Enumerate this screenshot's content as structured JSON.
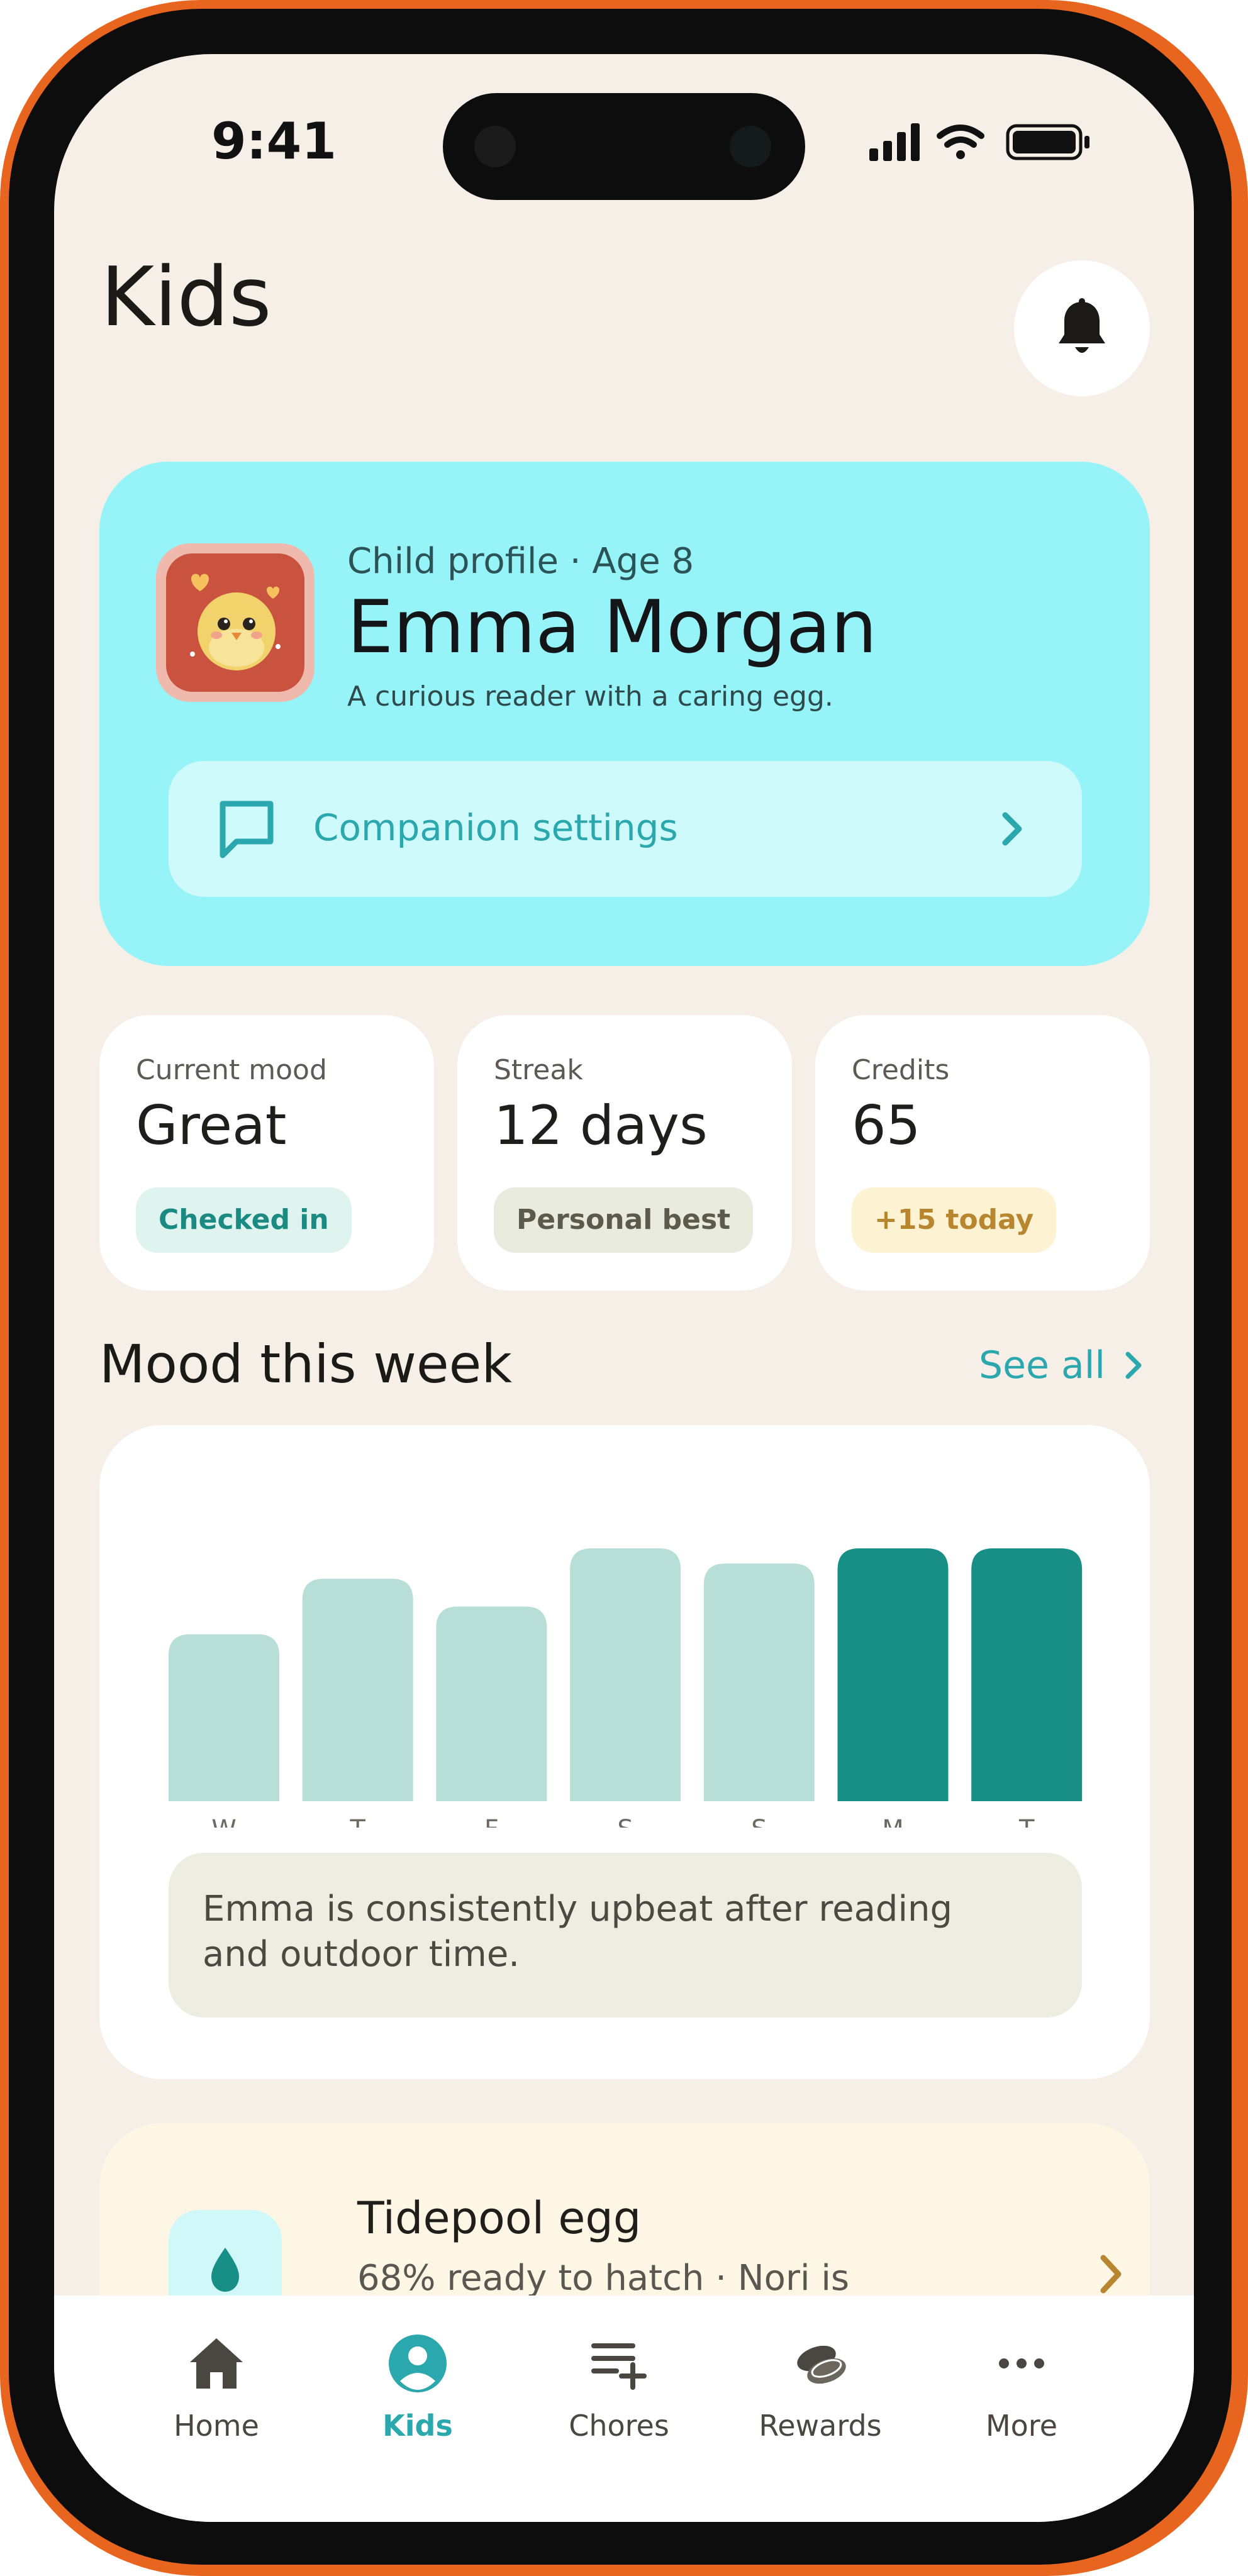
{
  "status_bar": {
    "time": "9:41"
  },
  "header": {
    "title": "Kids"
  },
  "profile": {
    "eyebrow": "Child profile · Age 8",
    "name": "Emma Morgan",
    "description": "A curious reader with a caring egg.",
    "companion_label": "Companion settings"
  },
  "stats": [
    {
      "label": "Current mood",
      "value": "Great",
      "badge": "Checked in"
    },
    {
      "label": "Streak",
      "value": "12 days",
      "badge": "Personal best"
    },
    {
      "label": "Credits",
      "value": "65",
      "badge": "+15 today"
    }
  ],
  "mood_section": {
    "title": "Mood this week",
    "see_all": "See all",
    "insight": "Emma is consistently upbeat after reading and outdoor time."
  },
  "chart_data": {
    "type": "bar",
    "categories": [
      "W",
      "T",
      "F",
      "S",
      "S",
      "M",
      "T"
    ],
    "values": [
      66,
      88,
      77,
      100,
      94,
      100,
      100
    ],
    "highlight": [
      false,
      false,
      false,
      false,
      false,
      true,
      true
    ],
    "ylim": [
      0,
      100
    ],
    "colors": {
      "default": "#b8ded8",
      "highlight": "#178f86"
    }
  },
  "egg": {
    "title": "Tidepool egg",
    "subtitle": "68% ready to hatch · Nori is"
  },
  "tabs": [
    {
      "label": "Home",
      "icon": "home-icon"
    },
    {
      "label": "Kids",
      "icon": "kid-icon"
    },
    {
      "label": "Chores",
      "icon": "chores-icon"
    },
    {
      "label": "Rewards",
      "icon": "rewards-icon"
    },
    {
      "label": "More",
      "icon": "more-icon"
    }
  ],
  "colors": {
    "accent": "#2aa8ae",
    "frame": "#e8651f",
    "background": "#f5efe8",
    "profile_card": "#96f4f8"
  }
}
